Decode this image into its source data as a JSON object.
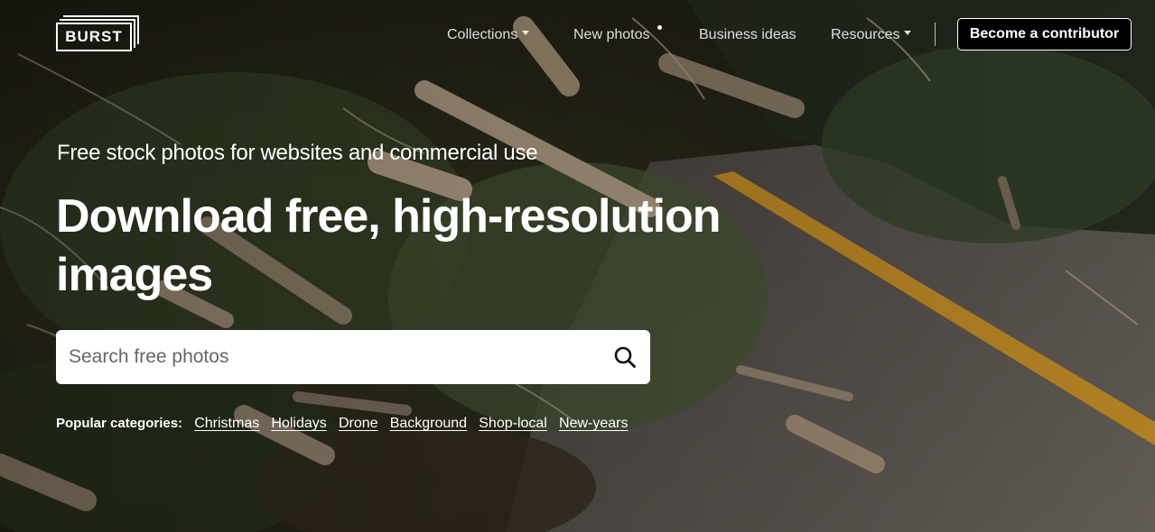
{
  "brand": {
    "logo_text": "BURST"
  },
  "nav": {
    "items": [
      {
        "label": "Collections",
        "has_caret": true
      },
      {
        "label": "New photos",
        "has_dot": true
      },
      {
        "label": "Business ideas"
      },
      {
        "label": "Resources",
        "has_caret": true
      }
    ],
    "contributor_button": "Become a contributor"
  },
  "hero": {
    "subtitle": "Free stock photos for websites and commercial use",
    "headline": "Download free, high-resolution images"
  },
  "search": {
    "placeholder": "Search free photos",
    "value": ""
  },
  "popular": {
    "label": "Popular categories:",
    "categories": [
      "Christmas",
      "Holidays",
      "Drone",
      "Background",
      "Shop-local",
      "New-years"
    ]
  },
  "colors": {
    "road_line": "#d99a1e",
    "button_bg": "#000000",
    "text": "#ffffff"
  },
  "icons": {
    "search": "search-icon",
    "caret": "caret-down-icon"
  }
}
